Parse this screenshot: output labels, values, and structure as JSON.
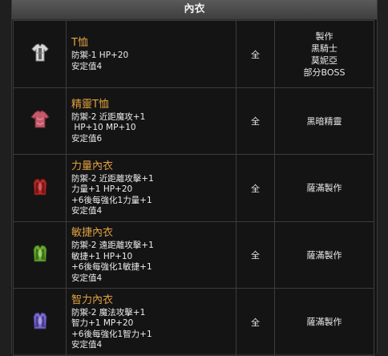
{
  "header": {
    "title": "內衣"
  },
  "items": [
    {
      "icon": "white-armor-icon",
      "name": "T恤",
      "stats": [
        "防禦-1 HP+20",
        "安定值4"
      ],
      "class": "全",
      "source": [
        "製作",
        "黑騎士",
        "莫妮亞",
        "部分BOSS"
      ],
      "colors": {
        "main": "#d8d8d8",
        "shade": "#8a8a8a",
        "accent": "#444444"
      }
    },
    {
      "icon": "pink-shirt-icon",
      "name": "精靈T恤",
      "stats": [
        "防禦-2 近距魔攻+1",
        " HP+10 MP+10",
        "安定值6"
      ],
      "class": "全",
      "source": [
        "黑暗精靈"
      ],
      "colors": {
        "main": "#c25a6a",
        "shade": "#7a2a38",
        "accent": "#e08a98"
      }
    },
    {
      "icon": "red-vest-icon",
      "name": "力量內衣",
      "stats": [
        "防禦-2 近距離攻擊+1",
        "力量+1 HP+20",
        "+6後每強化1力量+1",
        "安定值4"
      ],
      "class": "全",
      "source": [
        "薩滿製作"
      ],
      "colors": {
        "main": "#b02a2a",
        "shade": "#5a1010",
        "accent": "#e06060"
      }
    },
    {
      "icon": "green-vest-icon",
      "name": "敏捷內衣",
      "stats": [
        "防禦-2 遠距離攻擊+1",
        "敏捷+1 HP+10",
        "+6後每強化1敏捷+1",
        "安定值4"
      ],
      "class": "全",
      "source": [
        "薩滿製作"
      ],
      "colors": {
        "main": "#6aa832",
        "shade": "#2e5a12",
        "accent": "#a8e070"
      }
    },
    {
      "icon": "purple-vest-icon",
      "name": "智力內衣",
      "stats": [
        "防禦-2 魔法攻擊+1",
        "智力+1 MP+20",
        "+6後每強化1智力+1",
        "安定值4"
      ],
      "class": "全",
      "source": [
        "薩滿製作"
      ],
      "colors": {
        "main": "#7a6ac8",
        "shade": "#3a2e78",
        "accent": "#b0a8f0"
      }
    }
  ]
}
